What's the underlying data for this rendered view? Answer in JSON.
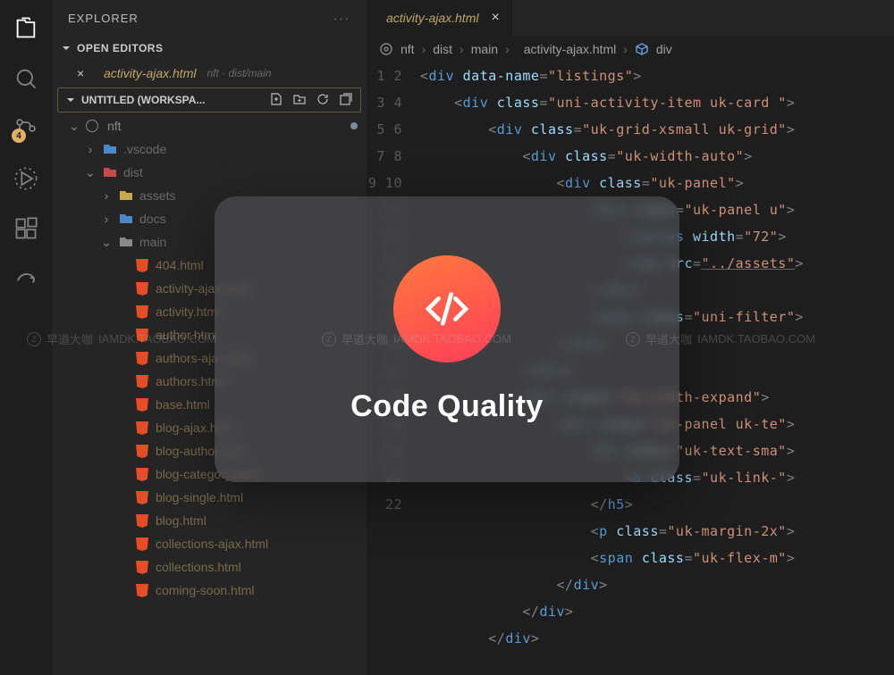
{
  "activity_bar": {
    "badge_count": "4"
  },
  "sidebar": {
    "title": "EXPLORER",
    "open_editors_label": "OPEN EDITORS",
    "open_editor": {
      "name": "activity-ajax.html",
      "path": "nft · dist/main"
    },
    "workspace_label": "UNTITLED (WORKSPA...",
    "tree": {
      "root": "nft",
      "vscode": ".vscode",
      "dist": "dist",
      "assets": "assets",
      "docs": "docs",
      "main": "main",
      "files": [
        "404.html",
        "activity-ajax.html",
        "activity.html",
        "author.html",
        "authors-ajax.html",
        "authors.html",
        "base.html",
        "blog-ajax.html",
        "blog-author.html",
        "blog-category.html",
        "blog-single.html",
        "blog.html",
        "collections-ajax.html",
        "collections.html",
        "coming-soon.html"
      ]
    }
  },
  "editor": {
    "tab_name": "activity-ajax.html",
    "breadcrumbs": [
      "nft",
      "dist",
      "main",
      "activity-ajax.html",
      "div"
    ],
    "lines": [
      {
        "n": "1",
        "indent": 0,
        "open": true,
        "tag": "div",
        "attrs": [
          [
            "data-name",
            "listings"
          ]
        ]
      },
      {
        "n": "2",
        "indent": 1,
        "open": true,
        "tag": "div",
        "attrs": [
          [
            "class",
            "uni-activity-item uk-card "
          ]
        ]
      },
      {
        "n": "3",
        "indent": 2,
        "open": true,
        "tag": "div",
        "attrs": [
          [
            "class",
            "uk-grid-xsmall uk-grid"
          ]
        ]
      },
      {
        "n": "4",
        "indent": 3,
        "open": true,
        "tag": "div",
        "attrs": [
          [
            "class",
            "uk-width-auto"
          ]
        ]
      },
      {
        "n": "5",
        "indent": 4,
        "open": true,
        "tag": "div",
        "attrs": [
          [
            "class",
            "uk-panel"
          ]
        ]
      },
      {
        "n": "6",
        "indent": 5,
        "open": true,
        "tag": "div",
        "attrs": [
          [
            "class",
            "uk-panel u"
          ]
        ]
      },
      {
        "n": "7",
        "indent": 6,
        "open": true,
        "tag": "canvas",
        "attrs": [
          [
            "width",
            "72"
          ]
        ]
      },
      {
        "n": "8",
        "indent": 6,
        "open": true,
        "tag": "img",
        "attrs": [
          [
            "src",
            "../assets"
          ]
        ],
        "underline": true
      },
      {
        "n": "9",
        "indent": 5,
        "close": "div"
      },
      {
        "n": "10",
        "indent": 5,
        "open": true,
        "tag": "span",
        "attrs": [
          [
            "class",
            "uni-filter"
          ]
        ]
      },
      {
        "n": "11",
        "indent": 4,
        "close": "div"
      },
      {
        "n": "12",
        "indent": 3,
        "close": "div"
      },
      {
        "n": "13",
        "indent": 3,
        "open": true,
        "tag": "div",
        "attrs": [
          [
            "class",
            "uk-width-expand"
          ]
        ]
      },
      {
        "n": "14",
        "indent": 4,
        "open": true,
        "tag": "div",
        "attrs": [
          [
            "class",
            "uk-panel uk-te"
          ]
        ]
      },
      {
        "n": "15",
        "indent": 5,
        "open": true,
        "tag": "h5",
        "attrs": [
          [
            "class",
            "uk-text-sma"
          ]
        ]
      },
      {
        "n": "16",
        "indent": 6,
        "open": true,
        "tag": "a",
        "attrs": [
          [
            "class",
            "uk-link-"
          ]
        ]
      },
      {
        "n": "17",
        "indent": 5,
        "close": "h5"
      },
      {
        "n": "18",
        "indent": 5,
        "open": true,
        "tag": "p",
        "attrs": [
          [
            "class",
            "uk-margin-2x"
          ]
        ]
      },
      {
        "n": "19",
        "indent": 5,
        "open": true,
        "tag": "span",
        "attrs": [
          [
            "class",
            "uk-flex-m"
          ]
        ]
      },
      {
        "n": "20",
        "indent": 4,
        "close": "div"
      },
      {
        "n": "21",
        "indent": 3,
        "close": "div"
      },
      {
        "n": "22",
        "indent": 2,
        "close": "div"
      }
    ]
  },
  "overlay": {
    "title": "Code Quality"
  },
  "watermark": {
    "cn": "早道大咖",
    "url": "IAMDK.TAOBAO.COM"
  }
}
